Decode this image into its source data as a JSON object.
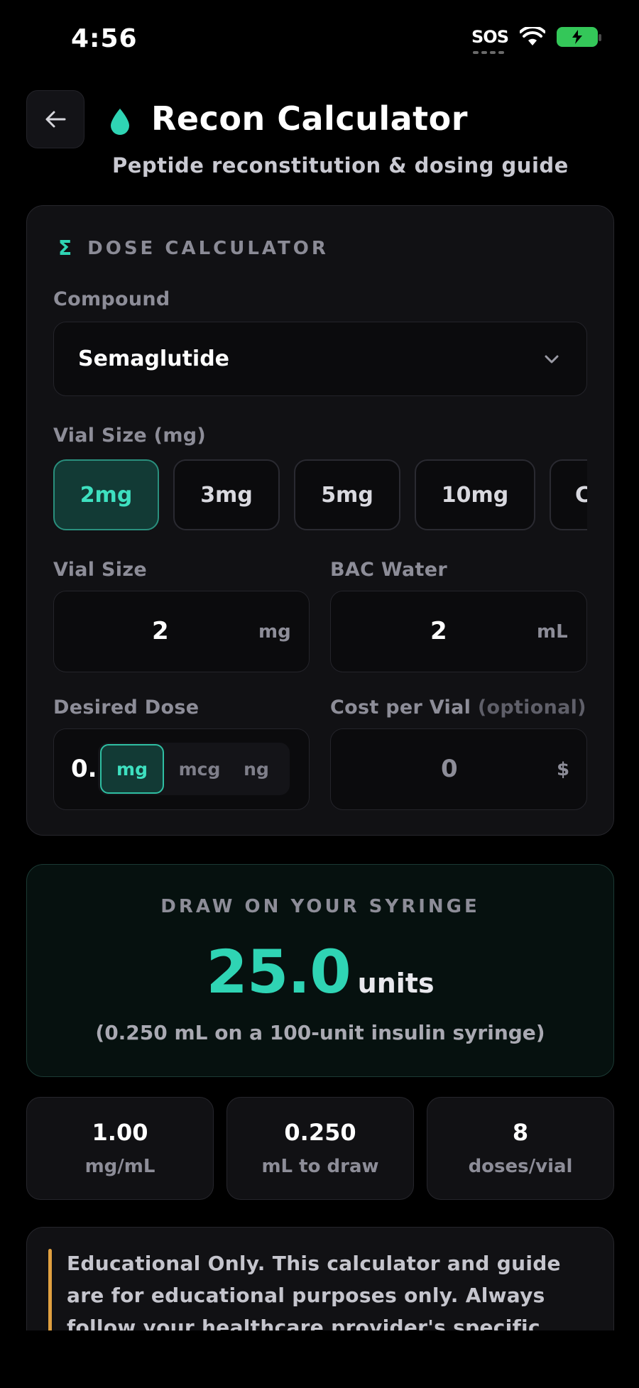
{
  "status_bar": {
    "time": "4:56",
    "sos": "SOS"
  },
  "header": {
    "title": "Recon Calculator",
    "subtitle": "Peptide reconstitution & dosing guide"
  },
  "calculator": {
    "section_title": "DOSE CALCULATOR",
    "compound_label": "Compound",
    "compound_value": "Semaglutide",
    "vial_size_label": "Vial Size (mg)",
    "vial_presets": [
      "2mg",
      "3mg",
      "5mg",
      "10mg",
      "C"
    ],
    "selected_preset": "2mg",
    "vial_size_field_label": "Vial Size",
    "vial_size_value": "2",
    "vial_size_unit": "mg",
    "bac_water_label": "BAC Water",
    "bac_water_value": "2",
    "bac_water_unit": "mL",
    "desired_dose_label": "Desired Dose",
    "desired_dose_value": "0.",
    "dose_units": [
      "mg",
      "mcg",
      "ng"
    ],
    "selected_dose_unit": "mg",
    "cost_label": "Cost per Vial",
    "cost_optional": "(optional)",
    "cost_value": "0",
    "cost_unit": "$"
  },
  "result": {
    "title": "DRAW ON YOUR SYRINGE",
    "units_value": "25.0",
    "units_label": "units",
    "note": "(0.250 mL on a 100-unit insulin syringe)"
  },
  "stats": [
    {
      "value": "1.00",
      "label": "mg/mL"
    },
    {
      "value": "0.250",
      "label": "mL to draw"
    },
    {
      "value": "8",
      "label": "doses/vial"
    }
  ],
  "disclaimer": {
    "text": "Educational Only. This calculator and guide are for educational purposes only. Always follow your healthcare provider's specific"
  },
  "colors": {
    "accent": "#2fd4b4",
    "background": "#000000",
    "card": "#111114",
    "warning_bar": "#e0a040",
    "battery": "#34c759"
  },
  "icons": {
    "back": "arrow-left-icon",
    "title": "water-drop-icon",
    "section": "sigma-icon",
    "select": "chevron-down-icon"
  }
}
